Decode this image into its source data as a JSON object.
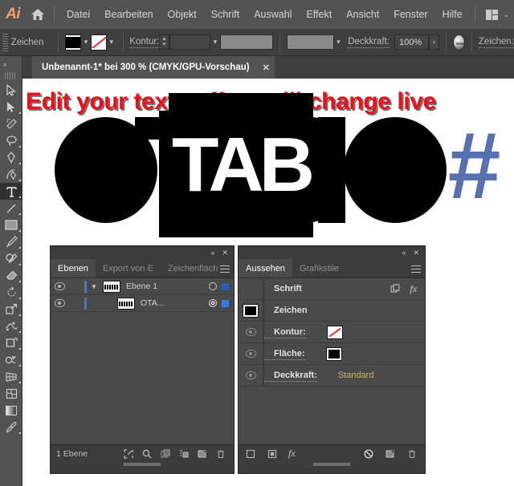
{
  "app": {
    "logo": "Ai",
    "home_icon": "home-icon"
  },
  "menubar": {
    "items": [
      {
        "label": "Datei"
      },
      {
        "label": "Bearbeiten"
      },
      {
        "label": "Objekt"
      },
      {
        "label": "Schrift"
      },
      {
        "label": "Auswahl"
      },
      {
        "label": "Effekt"
      },
      {
        "label": "Ansicht"
      },
      {
        "label": "Fenster"
      },
      {
        "label": "Hilfe"
      }
    ],
    "workspace_switcher_icon": "workspace-grid-icon",
    "workspace_caret": "⌄"
  },
  "controlbar": {
    "context_label": "Zeichen",
    "fill_swatch": "black-fill-swatch",
    "fill_color": "#000000",
    "stroke_swatch": "none-stroke-swatch",
    "stroke_label": "Kontur:",
    "stroke_weight_value": "",
    "stroke_profile_value": "",
    "opacity_label": "Deckkraft:",
    "opacity_value": "100%",
    "opacity_arrow": "›",
    "style_thumb_icon": "graphic-style-thumbnail",
    "char_label": "Zeichen:",
    "caret": "⌄"
  },
  "document_tab": {
    "title": "Unbenannt-1* bei 300 % (CMYK/GPU-Vorschau)",
    "close_icon": "✕"
  },
  "toolbar": {
    "expand_icon": "»",
    "tools": [
      {
        "name": "selection-tool",
        "active": false
      },
      {
        "name": "direct-selection-tool",
        "active": false
      },
      {
        "name": "magic-wand-tool",
        "active": false
      },
      {
        "name": "lasso-tool",
        "active": false
      },
      {
        "name": "pen-tool",
        "active": false
      },
      {
        "name": "curvature-tool",
        "active": false
      },
      {
        "name": "type-tool",
        "active": true
      },
      {
        "name": "line-segment-tool",
        "active": false
      },
      {
        "name": "rectangle-tool",
        "active": false
      },
      {
        "name": "paintbrush-tool",
        "active": false
      },
      {
        "name": "shaper-pencil-tool",
        "active": false
      },
      {
        "name": "eraser-tool",
        "active": false
      },
      {
        "name": "rotate-tool",
        "active": false
      },
      {
        "name": "scale-tool",
        "active": false
      },
      {
        "name": "width-warp-tool",
        "active": false
      },
      {
        "name": "free-transform-tool",
        "active": false
      },
      {
        "name": "shape-builder-tool",
        "active": false
      },
      {
        "name": "perspective-grid-tool",
        "active": false
      },
      {
        "name": "mesh-tool",
        "active": false
      },
      {
        "name": "gradient-tool",
        "active": false
      },
      {
        "name": "eyedropper-tool",
        "active": false
      }
    ]
  },
  "canvas": {
    "headline": "Edit your text - effect will change live",
    "headline_color": "#e8111c",
    "artwork_text": "OTABTO",
    "knockout_text": "TAB",
    "hash_glyph": "#",
    "hash_color": "#5771b0",
    "artwork_color": "#000000"
  },
  "layers_panel": {
    "collapse_icon": "«",
    "close_icon": "✕",
    "menu_icon": "panel-menu-icon",
    "tabs": [
      {
        "label": "Ebenen",
        "active": true
      },
      {
        "label": "Export von E",
        "active": false
      },
      {
        "label": "Zeichenfläch",
        "active": false
      }
    ],
    "rows": [
      {
        "name": "Ebene 1",
        "expanded": true,
        "sublayer": false,
        "targeted": false,
        "color": "#3c78d8"
      },
      {
        "name": "OTA...",
        "expanded": false,
        "sublayer": true,
        "targeted": true,
        "color": "#3c78d8"
      }
    ],
    "footer_label": "1 Ebene",
    "footer_icons": [
      {
        "name": "locate-object-icon"
      },
      {
        "name": "search-icon"
      },
      {
        "name": "make-clipping-mask-icon"
      },
      {
        "name": "create-new-sublayer-icon"
      },
      {
        "name": "create-new-layer-icon"
      },
      {
        "name": "delete-layer-icon"
      }
    ]
  },
  "appearance_panel": {
    "collapse_icon": "«",
    "close_icon": "✕",
    "menu_icon": "panel-menu-icon",
    "tabs": [
      {
        "label": "Aussehen",
        "active": true
      },
      {
        "label": "Grafikstile",
        "active": false
      }
    ],
    "rows": [
      {
        "name": "Schrift",
        "value": "",
        "swatch": "none",
        "eye": false,
        "dotted": false,
        "has_duplicate": true,
        "has_fx": true
      },
      {
        "name": "Zeichen",
        "value": "",
        "swatch": "black-left",
        "eye": false,
        "dotted": false
      },
      {
        "name": "Kontur:",
        "value": "",
        "swatch": "none",
        "eye": true,
        "dotted": true
      },
      {
        "name": "Fläche:",
        "value": "",
        "swatch": "black",
        "eye": true,
        "dotted": true
      },
      {
        "name": "Deckkraft:",
        "value": "Standard",
        "swatch": "",
        "eye": true,
        "dotted": true
      }
    ],
    "fx_label": "fx",
    "footer_icons": [
      {
        "name": "add-new-stroke-icon"
      },
      {
        "name": "add-new-fill-icon"
      },
      {
        "name": "fx-effects-icon"
      },
      {
        "name": "clear-appearance-icon"
      },
      {
        "name": "duplicate-item-icon"
      },
      {
        "name": "delete-item-icon"
      }
    ]
  }
}
